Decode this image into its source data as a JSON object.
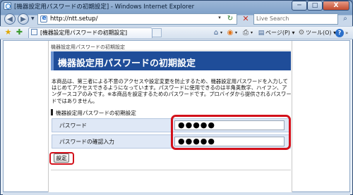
{
  "window": {
    "title": "[機器設定用パスワードの初期設定] - Windows Internet Explorer",
    "min_label": "─",
    "max_label": "□",
    "close_label": "X"
  },
  "nav": {
    "back_glyph": "◀",
    "forward_glyph": "▶",
    "dropdown_glyph": "▼",
    "address": "http://ntt.setup/",
    "address_dropdown_glyph": "▾",
    "refresh_glyph": "↻",
    "stop_glyph": "✕",
    "search_placeholder": "Live Search",
    "search_glyph": "⌕"
  },
  "toolbar": {
    "favorites_glyph": "★",
    "add_favorite_glyph": "✚",
    "tab_label": "[機器設定用パスワードの初期設定]",
    "home_glyph": "⌂",
    "feeds_glyph": "◉",
    "print_glyph": "⎙",
    "dropdown_glyph": "▾",
    "page_glyph": "▤",
    "page_menu": "ページ(P) ▾",
    "tools_glyph": "⚙",
    "tools_menu": "ツール(O) ▾",
    "help_glyph": "?",
    "more_glyph": "»"
  },
  "page": {
    "breadcrumb": "機器設定用パスワードの初期設定",
    "title": "機器設定用パスワードの初期設定",
    "description": "本商品は、第三者による不意のアクセスや設定変更を防止するため、機器設定用パスワードを入力してはじめてアクセスできるようになっています。パスワードに使用できるのは半角英数字、ハイフン、アンダースコアのみです。※本商品を設定するためのパスワードです。プロバイダから提供されるパスワードではありません。",
    "section_heading": "機器設定用パスワードの初期設定",
    "form": {
      "password_label": "パスワード",
      "password_value": "●●●●●",
      "confirm_label": "パスワードの確認入力",
      "confirm_value": "●●●●●"
    },
    "submit_label": "設定"
  },
  "colors": {
    "title_band": "#1f4d99",
    "highlight": "#d3111b",
    "form_row": "#dfe8f6"
  },
  "icons": [
    "ie-icon",
    "back-icon",
    "forward-icon",
    "refresh-icon",
    "stop-icon",
    "search-icon",
    "favorites-star-icon",
    "add-favorite-icon",
    "home-icon",
    "feeds-icon",
    "print-icon",
    "page-icon",
    "tools-icon",
    "help-icon"
  ]
}
